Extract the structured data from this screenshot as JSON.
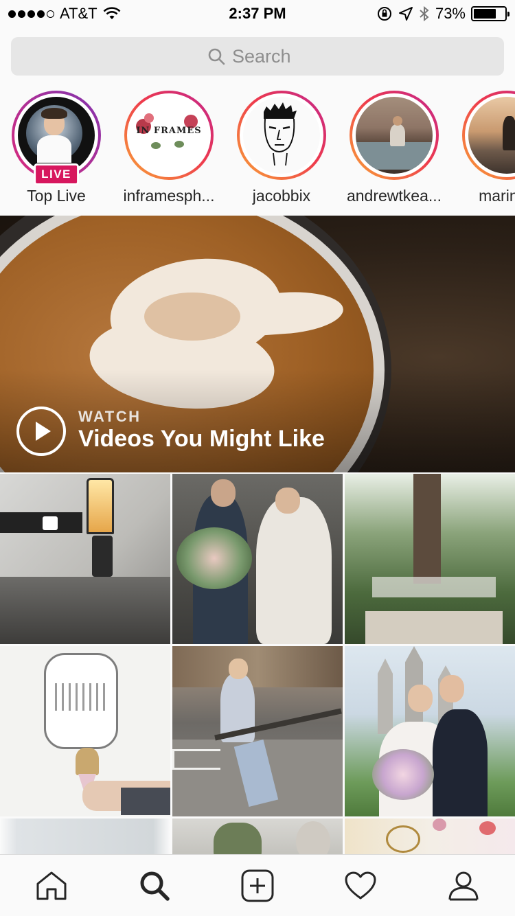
{
  "status_bar": {
    "carrier": "AT&T",
    "time": "2:37 PM",
    "battery": "73%",
    "battery_level": 0.73
  },
  "search": {
    "placeholder": "Search"
  },
  "stories": [
    {
      "name": "Top Live",
      "live": true,
      "badge": "LIVE"
    },
    {
      "name": "inframesph..."
    },
    {
      "name": "jacobbix"
    },
    {
      "name": "andrewtkea..."
    },
    {
      "name": "marinas"
    }
  ],
  "inframes_logo": "IN FRAMES",
  "video": {
    "kicker": "WATCH",
    "title": "Videos You Might Like"
  },
  "tab_bar": {
    "items": [
      "home-icon",
      "search-icon",
      "new-post-icon",
      "activity-icon",
      "profile-icon"
    ],
    "active": "search-icon"
  },
  "colors": {
    "story_gradient_start": "#f9a436",
    "story_gradient_end": "#c1248f",
    "live_badge": "#d7175e"
  }
}
